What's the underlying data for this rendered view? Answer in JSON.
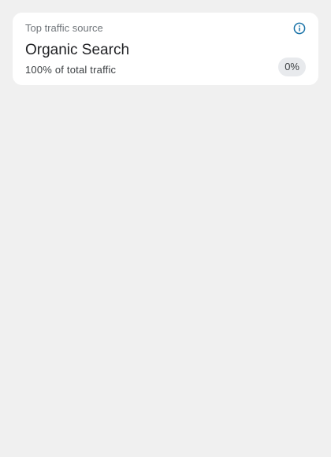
{
  "card": {
    "label": "Top traffic source",
    "source_name": "Organic Search",
    "share_text": "100% of total traffic",
    "change_badge": "0%",
    "info_icon": "info-icon"
  },
  "colors": {
    "page_background": "#f0f0f0",
    "card_background": "#ffffff",
    "info_icon": "#1a73a8",
    "badge_background": "#e8eaed"
  }
}
